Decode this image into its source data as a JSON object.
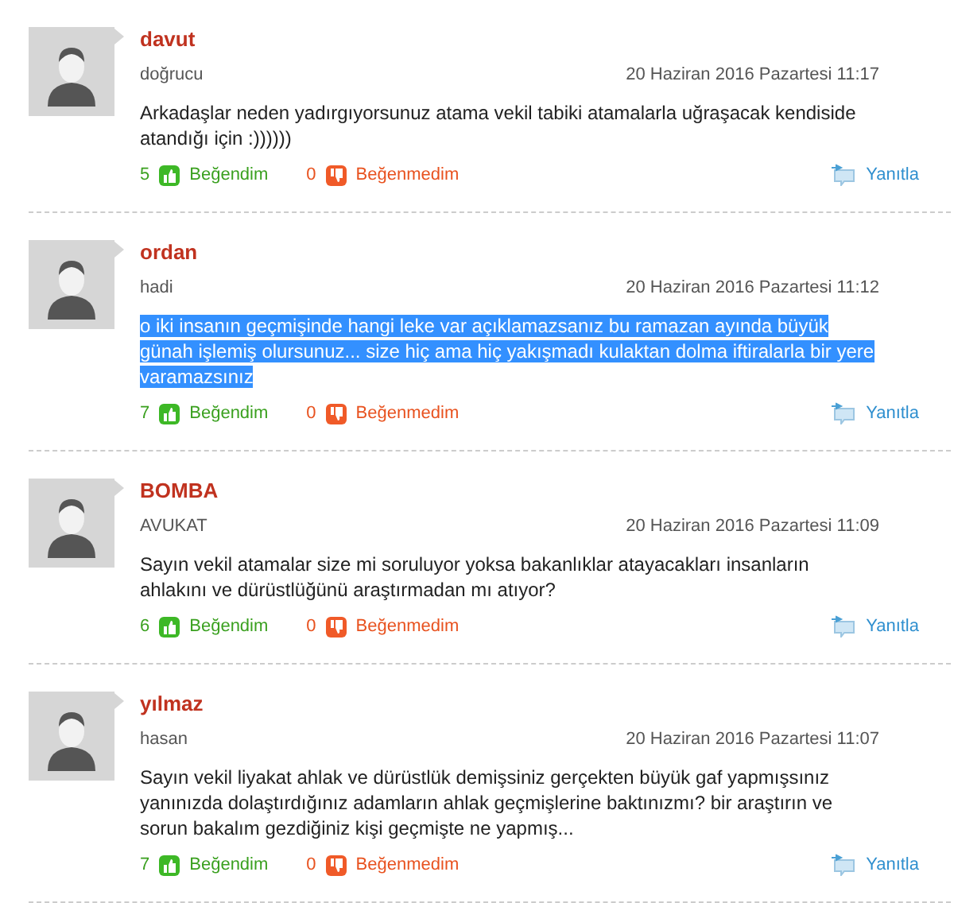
{
  "comments": [
    {
      "name": "davut",
      "handle": "doğrucu",
      "date": "20 Haziran 2016 Pazartesi 11:17",
      "text": "Arkadaşlar neden yadırgıyorsunuz atama vekil tabiki atamalarla uğraşacak kendiside atandığı için :))))))",
      "highlighted": false,
      "likes": "5",
      "like_label": "Beğendim",
      "dislikes": "0",
      "dislike_label": "Beğenmedim",
      "reply": "Yanıtla"
    },
    {
      "name": "ordan",
      "handle": "hadi",
      "date": "20 Haziran 2016 Pazartesi 11:12",
      "text": "o iki insanın geçmişinde hangi leke var açıklamazsanız bu ramazan ayında büyük günah işlemiş olursunuz... size hiç ama hiç yakışmadı kulaktan dolma iftiralarla bir yere varamazsınız",
      "highlighted": true,
      "likes": "7",
      "like_label": "Beğendim",
      "dislikes": "0",
      "dislike_label": "Beğenmedim",
      "reply": "Yanıtla"
    },
    {
      "name": "BOMBA",
      "handle": "AVUKAT",
      "date": "20 Haziran 2016 Pazartesi 11:09",
      "text": "Sayın vekil atamalar size mi soruluyor yoksa bakanlıklar atayacakları insanların ahlakını ve dürüstlüğünü araştırmadan mı atıyor?",
      "highlighted": false,
      "likes": "6",
      "like_label": "Beğendim",
      "dislikes": "0",
      "dislike_label": "Beğenmedim",
      "reply": "Yanıtla"
    },
    {
      "name": "yılmaz",
      "handle": "hasan",
      "date": "20 Haziran 2016 Pazartesi 11:07",
      "text": "Sayın vekil liyakat ahlak ve dürüstlük demişsiniz gerçekten büyük gaf yapmışsınız yanınızda dolaştırdığınız adamların ahlak geçmişlerine baktınızmı? bir araştırın ve sorun bakalım gezdiğiniz kişi geçmişte ne yapmış...",
      "highlighted": false,
      "likes": "7",
      "like_label": "Beğendim",
      "dislikes": "0",
      "dislike_label": "Beğenmedim",
      "reply": "Yanıtla"
    }
  ]
}
